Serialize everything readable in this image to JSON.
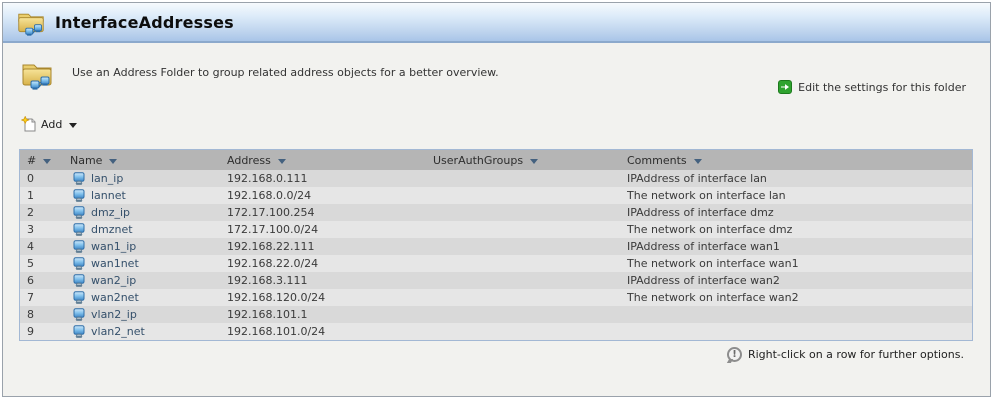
{
  "titlebar": {
    "title": "InterfaceAddresses"
  },
  "intro": {
    "description": "Use an Address Folder to group related address objects for a better overview.",
    "edit_link_label": "Edit the settings for this folder"
  },
  "toolbar": {
    "add_label": "Add"
  },
  "table": {
    "columns": [
      {
        "key": "num",
        "label": "#"
      },
      {
        "key": "name",
        "label": "Name"
      },
      {
        "key": "address",
        "label": "Address"
      },
      {
        "key": "userauthgroups",
        "label": "UserAuthGroups"
      },
      {
        "key": "comments",
        "label": "Comments"
      }
    ],
    "rows": [
      {
        "num": "0",
        "name": "lan_ip",
        "address": "192.168.0.111",
        "userauthgroups": "",
        "comments": "IPAddress of interface lan"
      },
      {
        "num": "1",
        "name": "lannet",
        "address": "192.168.0.0/24",
        "userauthgroups": "",
        "comments": "The network on interface lan"
      },
      {
        "num": "2",
        "name": "dmz_ip",
        "address": "172.17.100.254",
        "userauthgroups": "",
        "comments": "IPAddress of interface dmz"
      },
      {
        "num": "3",
        "name": "dmznet",
        "address": "172.17.100.0/24",
        "userauthgroups": "",
        "comments": "The network on interface dmz"
      },
      {
        "num": "4",
        "name": "wan1_ip",
        "address": "192.168.22.111",
        "userauthgroups": "",
        "comments": "IPAddress of interface wan1"
      },
      {
        "num": "5",
        "name": "wan1net",
        "address": "192.168.22.0/24",
        "userauthgroups": "",
        "comments": "The network on interface wan1"
      },
      {
        "num": "6",
        "name": "wan2_ip",
        "address": "192.168.3.111",
        "userauthgroups": "",
        "comments": "IPAddress of interface wan2"
      },
      {
        "num": "7",
        "name": "wan2net",
        "address": "192.168.120.0/24",
        "userauthgroups": "",
        "comments": "The network on interface wan2"
      },
      {
        "num": "8",
        "name": "vlan2_ip",
        "address": "192.168.101.1",
        "userauthgroups": "",
        "comments": ""
      },
      {
        "num": "9",
        "name": "vlan2_net",
        "address": "192.168.101.0/24",
        "userauthgroups": "",
        "comments": ""
      }
    ]
  },
  "footer": {
    "note": "Right-click on a row for further options."
  },
  "icons": {
    "title": "folder-network-icon",
    "intro": "folder-network-icon",
    "edit": "green-arrow-icon",
    "add": "new-item-icon",
    "row": "host-address-icon",
    "note": "info-icon",
    "sort": "sort-down-icon"
  },
  "colors": {
    "titlebar_top": "#f6fafd",
    "titlebar_bottom": "#a9c5e8",
    "titlebar_border": "#8ca9cc",
    "panel_bg": "#f2f2ef",
    "table_border": "#a3b8d4",
    "thead_bg": "#b5b5b5",
    "row_even": "#d9d9d9",
    "row_odd": "#e6e6e6",
    "sort_arrow": "#44617f",
    "edit_green": "#2fa32f"
  }
}
